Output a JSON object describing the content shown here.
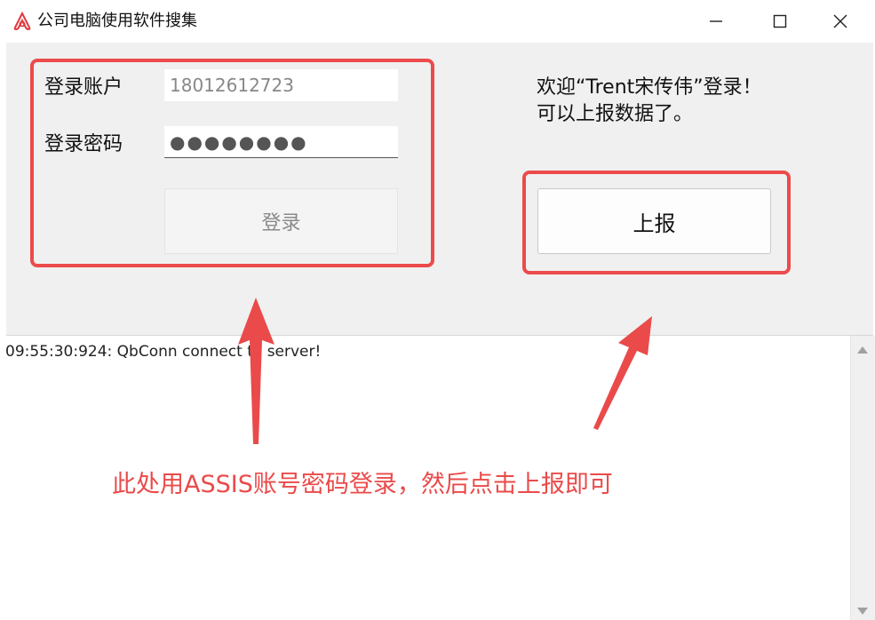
{
  "window": {
    "title": "公司电脑使用软件搜集",
    "icon": "app-logo-icon",
    "controls": [
      "minimize-icon",
      "maximize-icon",
      "close-icon"
    ]
  },
  "login": {
    "account_label": "登录账户",
    "account_value": "18012612723",
    "password_label": "登录密码",
    "password_value": "●●●●●●●●",
    "login_button": "登录"
  },
  "welcome": {
    "line1": "欢迎“Trent宋传伟”登录！",
    "line2": "可以上报数据了。"
  },
  "report_button": "上报",
  "log": {
    "line1": "09:55:30:924: QbConn connect to server!"
  },
  "annotation": {
    "text": "此处用ASSIS账号密码登录，然后点击上报即可",
    "color": "#ea4a4a"
  },
  "colors": {
    "highlight": "#ec4b4b",
    "panel": "#f0f0f0"
  }
}
